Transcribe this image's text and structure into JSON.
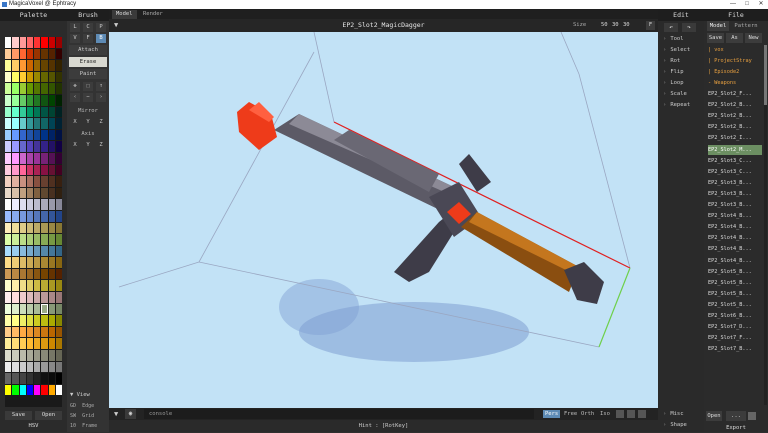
{
  "window": {
    "title": "MagicaVoxel @ Ephtracy",
    "controls": [
      "—",
      "□",
      "✕"
    ]
  },
  "palette": {
    "title": "Palette",
    "save_label": "Save",
    "open_label": "Open",
    "mode_label": "HSV",
    "colors": [
      "#ffffff",
      "#ffcccc",
      "#ff9999",
      "#ff6666",
      "#ff3333",
      "#ff0000",
      "#cc0000",
      "#990000",
      "#ffcc99",
      "#ff9966",
      "#ff6633",
      "#cc3300",
      "#993300",
      "#663300",
      "#552200",
      "#330000",
      "#ffff99",
      "#ffcc66",
      "#ff9933",
      "#cc6600",
      "#996600",
      "#664400",
      "#553300",
      "#332200",
      "#ffffcc",
      "#ffff66",
      "#ffcc33",
      "#cc9900",
      "#998800",
      "#666600",
      "#555500",
      "#333300",
      "#ccff99",
      "#99ff66",
      "#99cc33",
      "#669900",
      "#557700",
      "#446600",
      "#335500",
      "#223300",
      "#ccffcc",
      "#99ff99",
      "#66cc66",
      "#339933",
      "#227722",
      "#115511",
      "#004400",
      "#002200",
      "#99ffcc",
      "#66ffcc",
      "#33cc99",
      "#009966",
      "#007755",
      "#005544",
      "#004433",
      "#002222",
      "#ccffff",
      "#99ffff",
      "#66cccc",
      "#339999",
      "#227777",
      "#116666",
      "#004455",
      "#002233",
      "#99ccff",
      "#6699ff",
      "#3366cc",
      "#2255aa",
      "#114499",
      "#003388",
      "#002266",
      "#001144",
      "#ccccff",
      "#9999ff",
      "#6666cc",
      "#5544bb",
      "#443399",
      "#332288",
      "#221166",
      "#110044",
      "#ffccff",
      "#ff99ff",
      "#cc66cc",
      "#aa44aa",
      "#993399",
      "#772277",
      "#551155",
      "#330033",
      "#ffcce0",
      "#ff99cc",
      "#ff6699",
      "#cc3366",
      "#aa2255",
      "#881144",
      "#661133",
      "#440022",
      "#f2d0c0",
      "#e0b0a0",
      "#c89080",
      "#a87060",
      "#885040",
      "#684030",
      "#503020",
      "#382010",
      "#e8d8c8",
      "#d8c0a8",
      "#c0a080",
      "#a08060",
      "#806040",
      "#604830",
      "#483020",
      "#302010",
      "#ffffff",
      "#eeeeff",
      "#ddddee",
      "#ccccdd",
      "#bbbbcc",
      "#aaaabb",
      "#9999aa",
      "#888899",
      "#99bbff",
      "#88aaee",
      "#7799dd",
      "#6688cc",
      "#5577bb",
      "#4466aa",
      "#335599",
      "#224488",
      "#ffeebb",
      "#eedd99",
      "#ddcc88",
      "#ccbb77",
      "#bbaa66",
      "#aa9955",
      "#998844",
      "#887733",
      "#ddffaa",
      "#ccee99",
      "#bbdd88",
      "#aacc77",
      "#99bb66",
      "#88aa55",
      "#779944",
      "#668833",
      "#aaddff",
      "#99ccee",
      "#88bbdd",
      "#77aacc",
      "#6699bb",
      "#5588aa",
      "#447799",
      "#336688",
      "#ffdd88",
      "#eecc77",
      "#ddbb66",
      "#ccaa55",
      "#bb9944",
      "#aa8833",
      "#997722",
      "#886611",
      "#cc9955",
      "#bb8844",
      "#aa7733",
      "#996622",
      "#885511",
      "#774400",
      "#663300",
      "#552200",
      "#ffffcc",
      "#ffeeaa",
      "#eedd88",
      "#ddcc66",
      "#ccbb44",
      "#bbaa33",
      "#aa9922",
      "#998811",
      "#ffeeee",
      "#ffdddd",
      "#eecccc",
      "#ddbbbb",
      "#ccaaaa",
      "#bb9999",
      "#aa8888",
      "#997777",
      "#eeffdd",
      "#ddeecc",
      "#ccddbb",
      "#bbccaa",
      "#aabb99",
      "#99aa88",
      "#889977",
      "#778866",
      "#ffffaa",
      "#ffff88",
      "#eeee66",
      "#dddd44",
      "#cccc22",
      "#bbbb11",
      "#aaaa00",
      "#888800",
      "#ffcc88",
      "#ffbb66",
      "#ffaa44",
      "#ee9933",
      "#dd8822",
      "#cc7711",
      "#bb6600",
      "#995500",
      "#ffee99",
      "#ffdd77",
      "#ffcc55",
      "#ffbb33",
      "#eeaa22",
      "#dd9911",
      "#cc8800",
      "#aa7700",
      "#ddddcc",
      "#ccccbb",
      "#bbbbaa",
      "#aaaa99",
      "#999988",
      "#888877",
      "#777766",
      "#666655",
      "#eeeeee",
      "#dddddd",
      "#cccccc",
      "#bbbbbb",
      "#aaaaaa",
      "#999999",
      "#888888",
      "#777777",
      "#666666",
      "#555555",
      "#444444",
      "#333333",
      "#222222",
      "#111111",
      "#0a0a0a",
      "#000000",
      "#ffff00",
      "#00ff00",
      "#00ffff",
      "#0000ff",
      "#ff00ff",
      "#ff0000",
      "#ffaa00",
      "#ffffff"
    ],
    "selected_index": 189
  },
  "brush": {
    "title": "Brush",
    "types": [
      "L",
      "C",
      "P",
      "V",
      "F",
      "B"
    ],
    "modes": [
      "Attach",
      "Erase",
      "Paint"
    ],
    "active_mode": "Erase",
    "mirror_title": "Mirror",
    "mirror": [
      "X",
      "Y",
      "Z"
    ],
    "axis_title": "Axis",
    "axis": [
      "X",
      "Y",
      "Z"
    ],
    "view_title": "View",
    "view_items": [
      {
        "key": "GD",
        "label": "Edge"
      },
      {
        "key": "SW",
        "label": "Grid"
      },
      {
        "key": "10",
        "label": "Frame"
      }
    ]
  },
  "viewport": {
    "tabs": [
      "Model",
      "Render"
    ],
    "active_tab": "Model",
    "model_name": "EP2_Slot2_MagicDagger",
    "size_label": "Size",
    "size": [
      "50",
      "30",
      "30"
    ],
    "fit_label": "F",
    "console_placeholder": "console",
    "camera_modes": [
      "Pers",
      "Free",
      "Orth",
      "Iso"
    ],
    "active_camera": "Pers",
    "hint": "Hint : [RotKey]",
    "canvas_bg": "#c2e2f6",
    "blade_color": "#5c5a66",
    "guard_color": "#3e3c48",
    "handle_color": "#8a4e10",
    "gem_color": "#ee3b1a"
  },
  "edit": {
    "title": "Edit",
    "items": [
      "Tool",
      "Select",
      "Rot",
      "Flip",
      "Loop",
      "Scale",
      "Repeat"
    ],
    "bottom": [
      "Misc",
      "Shape"
    ]
  },
  "file": {
    "title": "File",
    "tabs": [
      "Model",
      "Pattern"
    ],
    "actions": [
      "Save",
      "As",
      "New"
    ],
    "folders": [
      "| vox",
      "| ProjectStray",
      "| Episode2",
      "- Weapons"
    ],
    "files": [
      "EP2_Slot2_F...",
      "EP2_Slot2_B...",
      "EP2_Slot2_B...",
      "EP2_Slot2_B...",
      "EP2_Slot2_I...",
      "EP2_Slot2_M...",
      "EP2_Slot3_C...",
      "EP2_Slot3_C...",
      "EP2_Slot3_B...",
      "EP2_Slot3_B...",
      "EP2_Slot3_B...",
      "EP2_Slot4_B...",
      "EP2_Slot4_B...",
      "EP2_Slot4_B...",
      "EP2_Slot4_B...",
      "EP2_Slot4_B...",
      "EP2_Slot5_B...",
      "EP2_Slot5_B...",
      "EP2_Slot5_B...",
      "EP2_Slot5_B...",
      "EP2_Slot6_B...",
      "EP2_Slot7_D...",
      "EP2_Slot7_F...",
      "EP2_Slot7_B..."
    ],
    "selected_file": 5,
    "open_label": "Open",
    "more_label": "...",
    "export_label": "Export"
  }
}
